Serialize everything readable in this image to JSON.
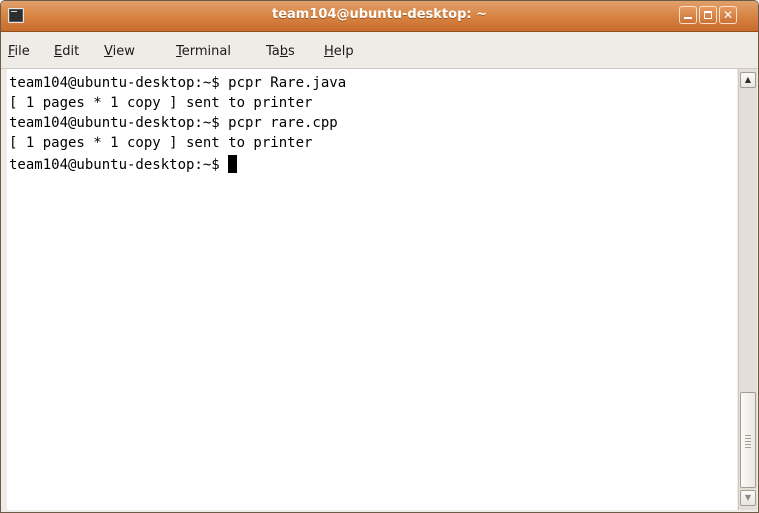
{
  "window": {
    "title": "team104@ubuntu-desktop: ~"
  },
  "menu": {
    "items": [
      {
        "mnemonic": "F",
        "rest": "ile"
      },
      {
        "mnemonic": "E",
        "rest": "dit"
      },
      {
        "mnemonic": "V",
        "rest": "iew"
      },
      {
        "mnemonic": "T",
        "rest": "erminal"
      },
      {
        "before": "Ta",
        "mnemonic": "b",
        "rest": "s"
      },
      {
        "mnemonic": "H",
        "rest": "elp"
      }
    ]
  },
  "terminal": {
    "lines": [
      "team104@ubuntu-desktop:~$ pcpr Rare.java",
      "[ 1 pages * 1 copy ] sent to printer",
      "team104@ubuntu-desktop:~$ pcpr rare.cpp",
      "[ 1 pages * 1 copy ] sent to printer"
    ],
    "prompt": "team104@ubuntu-desktop:~$ "
  },
  "icons": {
    "app": "terminal-icon",
    "minimize": "minimize-icon",
    "maximize": "maximize-icon",
    "close": "close-icon",
    "scroll_up": "arrow-up-icon",
    "scroll_down": "arrow-down-icon"
  },
  "colors": {
    "titlebar": "#d98746",
    "terminal_bg": "#ffffff",
    "terminal_fg": "#000000",
    "window_bg": "#efebe7"
  }
}
